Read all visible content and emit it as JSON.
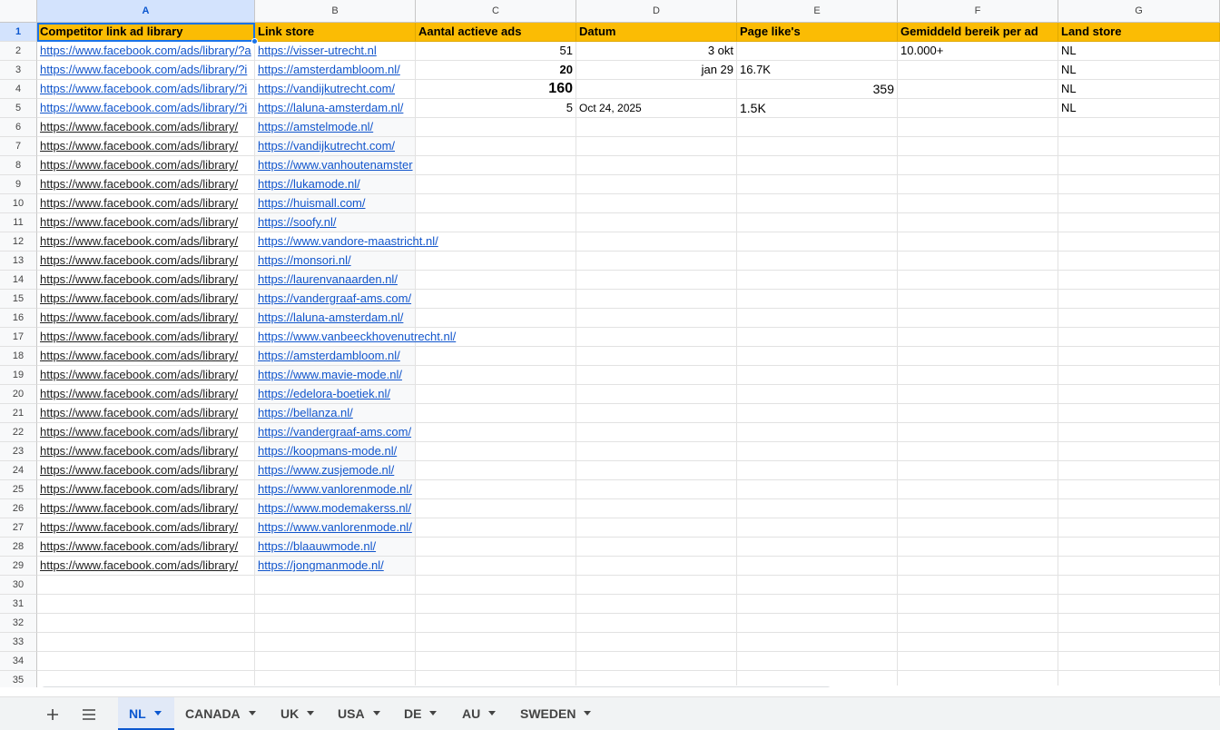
{
  "columns": [
    "A",
    "B",
    "C",
    "D",
    "E",
    "F",
    "G"
  ],
  "rows": [
    "1",
    "2",
    "3",
    "4",
    "5",
    "6",
    "7",
    "8",
    "9",
    "10",
    "11",
    "12",
    "13",
    "14",
    "15",
    "16",
    "17",
    "18",
    "19",
    "20",
    "21",
    "22",
    "23",
    "24",
    "25",
    "26",
    "27",
    "28",
    "29",
    "30",
    "31",
    "32",
    "33",
    "34",
    "35"
  ],
  "headers": [
    "Competitor link ad library",
    "Link store",
    "Aantal actieve ads",
    "Datum",
    "Page like's",
    "Gemiddeld bereik per ad",
    "Land store"
  ],
  "data_rows": [
    {
      "a": "https://www.facebook.com/ads/library/?a",
      "b": "https://visser-utrecht.nl",
      "c": "51",
      "d": "3 okt",
      "e": "",
      "f": "10.000+",
      "g": "NL"
    },
    {
      "a": "https://www.facebook.com/ads/library/?i",
      "b": "https://amsterdambloom.nl/",
      "c": "20",
      "d": "jan 29",
      "e": "16.7K",
      "f": "",
      "g": "NL"
    },
    {
      "a": "https://www.facebook.com/ads/library/?i",
      "b": "https://vandijkutrecht.com/",
      "c": "160",
      "d": "",
      "e": "359",
      "f": "",
      "g": "NL"
    },
    {
      "a": "https://www.facebook.com/ads/library/?i",
      "b": "https://laluna-amsterdam.nl/",
      "c": "5",
      "d": "Oct 24, 2025",
      "e": "1.5K",
      "f": "",
      "g": "NL"
    }
  ],
  "link_rows": [
    {
      "a": "https://www.facebook.com/ads/library/",
      "b": "https://amstelmode.nl/"
    },
    {
      "a": "https://www.facebook.com/ads/library/",
      "b": "https://vandijkutrecht.com/"
    },
    {
      "a": "https://www.facebook.com/ads/library/",
      "b": "https://www.vanhoutenamster"
    },
    {
      "a": "https://www.facebook.com/ads/library/",
      "b": "https://lukamode.nl/"
    },
    {
      "a": "https://www.facebook.com/ads/library/",
      "b": "https://huismall.com/"
    },
    {
      "a": "https://www.facebook.com/ads/library/",
      "b": "https://soofy.nl/"
    },
    {
      "a": "https://www.facebook.com/ads/library/",
      "b": "https://www.vandore-maastricht.nl/"
    },
    {
      "a": "https://www.facebook.com/ads/library/",
      "b": "https://monsori.nl/"
    },
    {
      "a": "https://www.facebook.com/ads/library/",
      "b": "https://laurenvanaarden.nl/"
    },
    {
      "a": "https://www.facebook.com/ads/library/",
      "b": "https://vandergraaf-ams.com/"
    },
    {
      "a": "https://www.facebook.com/ads/library/",
      "b": "https://laluna-amsterdam.nl/"
    },
    {
      "a": "https://www.facebook.com/ads/library/",
      "b": "https://www.vanbeeckhovenutrecht.nl/"
    },
    {
      "a": "https://www.facebook.com/ads/library/",
      "b": "https://amsterdambloom.nl/"
    },
    {
      "a": "https://www.facebook.com/ads/library/",
      "b": "https://www.mavie-mode.nl/"
    },
    {
      "a": "https://www.facebook.com/ads/library/",
      "b": "https://edelora-boetiek.nl/"
    },
    {
      "a": "https://www.facebook.com/ads/library/",
      "b": "https://bellanza.nl/"
    },
    {
      "a": "https://www.facebook.com/ads/library/",
      "b": "https://vandergraaf-ams.com/"
    },
    {
      "a": "https://www.facebook.com/ads/library/",
      "b": "https://koopmans-mode.nl/"
    },
    {
      "a": "https://www.facebook.com/ads/library/",
      "b": "https://www.zusjemode.nl/"
    },
    {
      "a": "https://www.facebook.com/ads/library/",
      "b": "https://www.vanlorenmode.nl/"
    },
    {
      "a": "https://www.facebook.com/ads/library/",
      "b": "https://www.modemakerss.nl/"
    },
    {
      "a": "https://www.facebook.com/ads/library/",
      "b": "https://www.vanlorenmode.nl/"
    },
    {
      "a": "https://www.facebook.com/ads/library/",
      "b": "https://blaauwmode.nl/"
    },
    {
      "a": "https://www.facebook.com/ads/library/",
      "b": "https://jongmanmode.nl/"
    }
  ],
  "tabs": [
    "NL",
    "CANADA",
    "UK",
    "USA",
    "DE",
    "AU",
    "SWEDEN"
  ],
  "colors": {
    "header_fill": "#fbbc04",
    "link": "#1155cc",
    "selection": "#1a73e8",
    "active_tab": "#0b57d0"
  }
}
